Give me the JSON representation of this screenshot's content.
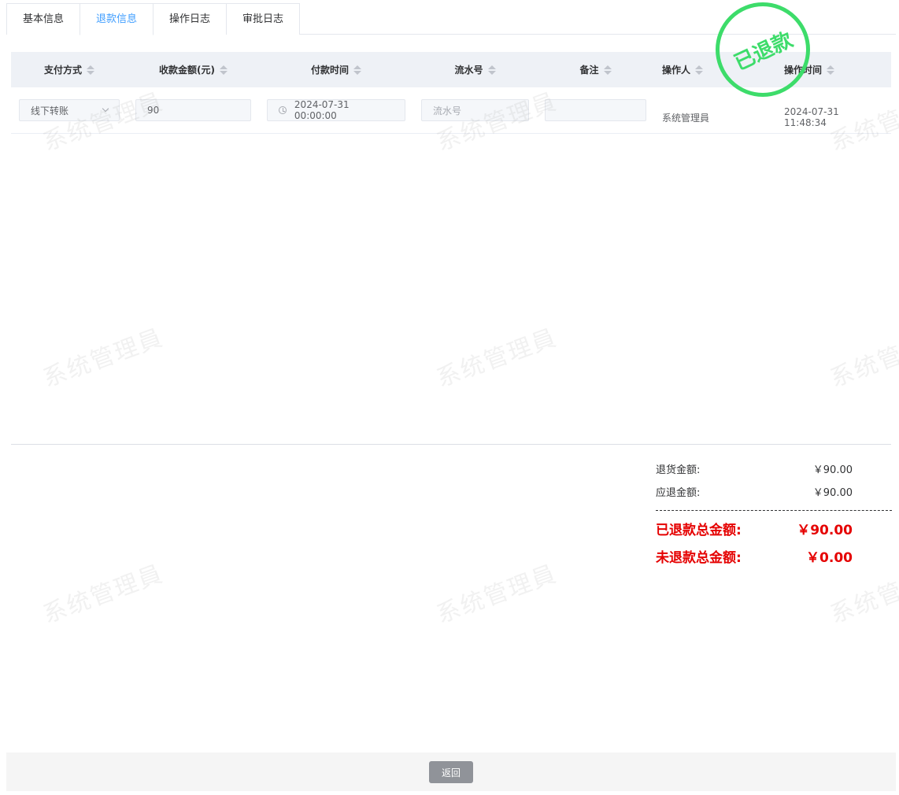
{
  "tabs": [
    {
      "label": "基本信息"
    },
    {
      "label": "退款信息"
    },
    {
      "label": "操作日志"
    },
    {
      "label": "审批日志"
    }
  ],
  "table": {
    "headers": [
      "支付方式",
      "收款金额(元)",
      "付款时间",
      "流水号",
      "备注",
      "操作人",
      "操作时间"
    ],
    "row": {
      "payment_method": "线下转账",
      "amount": "90",
      "pay_time": "2024-07-31 00:00:00",
      "serial_placeholder": "流水号",
      "remark": "",
      "operator": "系统管理員",
      "op_time": "2024-07-31 11:48:34"
    }
  },
  "stamp": {
    "text": "已退款",
    "color": "#3ddc6a"
  },
  "summary": {
    "return_label": "退货金额:",
    "return_value": "￥90.00",
    "due_label": "应退金额:",
    "due_value": "￥90.00",
    "refunded_label": "已退款总金额:",
    "refunded_value": "￥90.00",
    "unrefunded_label": "未退款总金额:",
    "unrefunded_value": "￥0.00"
  },
  "watermark": "系统管理員",
  "back_label": "返回",
  "colors": {
    "active_tab": "#409eff",
    "header_bg": "#eef1f6",
    "alert_red": "#e50000",
    "stamp_green": "#3ddc6a"
  }
}
